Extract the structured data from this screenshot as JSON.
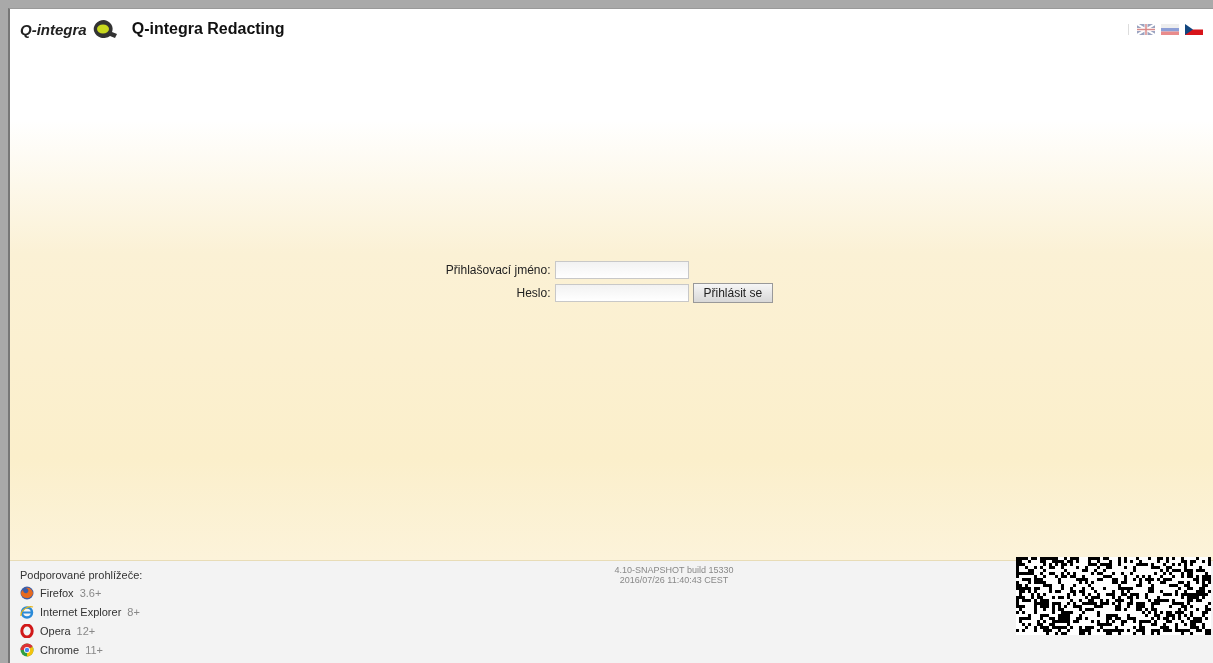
{
  "header": {
    "logo_text": "Q-integra",
    "title": "Q-integra Redacting"
  },
  "languages": [
    {
      "kind": "uk"
    },
    {
      "kind": "sk"
    },
    {
      "kind": "cz"
    }
  ],
  "login": {
    "username_label": "Přihlašovací jméno:",
    "password_label": "Heslo:",
    "submit": "Přihlásit se"
  },
  "footer": {
    "browsers_title": "Podporované prohlížeče:",
    "browsers": [
      {
        "kind": "firefox",
        "name": "Firefox",
        "version": "3.6+"
      },
      {
        "kind": "ie",
        "name": "Internet Explorer",
        "version": "8+"
      },
      {
        "kind": "opera",
        "name": "Opera",
        "version": "12+"
      },
      {
        "kind": "chrome",
        "name": "Chrome",
        "version": "11+"
      }
    ],
    "version": "4.10-SNAPSHOT build 15330",
    "build_date": "2016/07/26 11:40:43 CEST"
  }
}
